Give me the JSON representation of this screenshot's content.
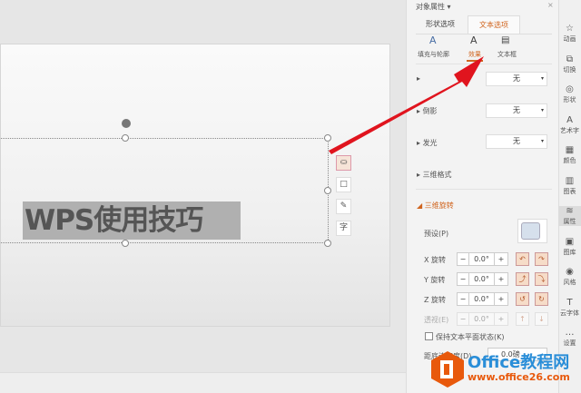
{
  "slide": {
    "title_text": "WPS使用技巧",
    "quick_tools": [
      "fill-icon",
      "border-icon",
      "pen-icon",
      "text-icon"
    ]
  },
  "panel": {
    "header": "对象属性 ▾",
    "close": "×",
    "tabs": [
      "形状选项",
      "文本选项"
    ],
    "subtabs": [
      "填充与轮廓",
      "效果",
      "文本框"
    ],
    "rows": [
      {
        "label": "",
        "value": "无"
      },
      {
        "label": "倒影",
        "value": "无"
      },
      {
        "label": "发光",
        "value": "无"
      }
    ],
    "section_3d_format": "三维格式",
    "section_3d_rotation": "三维旋转",
    "preset_label": "预设(P)",
    "rotations": [
      {
        "label": "X 旋转",
        "value": "0.0°"
      },
      {
        "label": "Y 旋转",
        "value": "0.0°"
      },
      {
        "label": "Z 旋转",
        "value": "0.0°"
      },
      {
        "label": "透视(E)",
        "value": "0.0°"
      }
    ],
    "keep_flat": "保持文本平面状态(K)",
    "distance_label": "距底边高度(D)",
    "distance_value": "0.0磅"
  },
  "sidebar": [
    "动画",
    "切换",
    "形状",
    "艺术字",
    "颜色",
    "图表",
    "属性",
    "图库",
    "风格",
    "云字体",
    "设置"
  ],
  "watermark": {
    "brand": "Office教程网",
    "url": "www.office26.com"
  },
  "colors": {
    "accent": "#d0641e",
    "arrow": "#e0141e"
  }
}
